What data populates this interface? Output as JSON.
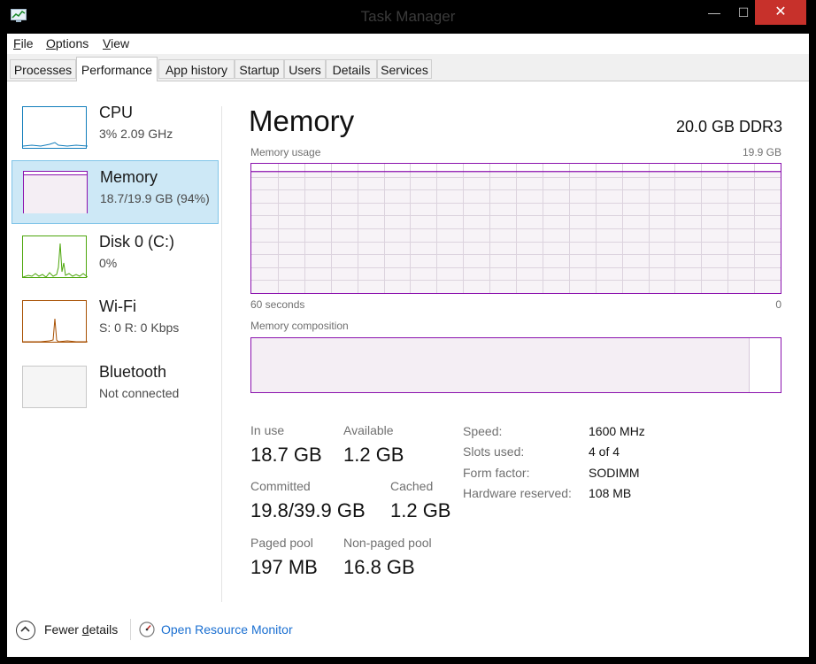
{
  "window": {
    "title": "Task Manager",
    "minimize": "—",
    "maximize": "☐",
    "close": "✕"
  },
  "menu": [
    {
      "label": "File",
      "accel": "F",
      "rest": "ile"
    },
    {
      "label": "Options",
      "accel": "O",
      "rest": "ptions"
    },
    {
      "label": "View",
      "accel": "V",
      "rest": "iew"
    }
  ],
  "tabs": [
    "Processes",
    "Performance",
    "App history",
    "Startup",
    "Users",
    "Details",
    "Services"
  ],
  "active_tab": "Performance",
  "sidebar": [
    {
      "title": "CPU",
      "subtitle": "3%  2.09 GHz",
      "color": "#117dbb"
    },
    {
      "title": "Memory",
      "subtitle": "18.7/19.9 GB (94%)",
      "color": "#8b12ae"
    },
    {
      "title": "Disk 0 (C:)",
      "subtitle": "0%",
      "color": "#4da60c"
    },
    {
      "title": "Wi-Fi",
      "subtitle": "S: 0  R: 0 Kbps",
      "color": "#a74f01"
    },
    {
      "title": "Bluetooth",
      "subtitle": "Not connected",
      "color": "#c8c8c8"
    }
  ],
  "selected_item": "Memory",
  "main": {
    "title": "Memory",
    "spec": "20.0 GB DDR3",
    "usage_label": "Memory usage",
    "usage_max": "19.9 GB",
    "time_label": "60 seconds",
    "time_min": "0",
    "usage_fraction": 0.94,
    "composition_label": "Memory composition",
    "composition_in_use_fraction": 0.94
  },
  "stats": {
    "in_use": {
      "label": "In use",
      "value": "18.7 GB"
    },
    "available": {
      "label": "Available",
      "value": "1.2 GB"
    },
    "committed": {
      "label": "Committed",
      "value": "19.8/39.9 GB"
    },
    "cached": {
      "label": "Cached",
      "value": "1.2 GB"
    },
    "paged_pool": {
      "label": "Paged pool",
      "value": "197 MB"
    },
    "nonpaged_pool": {
      "label": "Non-paged pool",
      "value": "16.8 GB"
    }
  },
  "properties": {
    "speed": {
      "label": "Speed:",
      "value": "1600 MHz"
    },
    "slots": {
      "label": "Slots used:",
      "value": "4 of 4"
    },
    "form": {
      "label": "Form factor:",
      "value": "SODIMM"
    },
    "reserved": {
      "label": "Hardware reserved:",
      "value": "108 MB"
    }
  },
  "footer": {
    "fewer_details": "Fewer details",
    "fewer_accel": "d",
    "open_resmon": "Open Resource Monitor"
  },
  "colors": {
    "memory": "#8b12ae",
    "memory_fill": "#f4eef4",
    "selected_bg": "#cde8f6",
    "link": "#1a6fd1",
    "close": "#c7312b"
  },
  "icons": [
    "app-icon",
    "chevron-up-icon",
    "resource-monitor-icon"
  ]
}
